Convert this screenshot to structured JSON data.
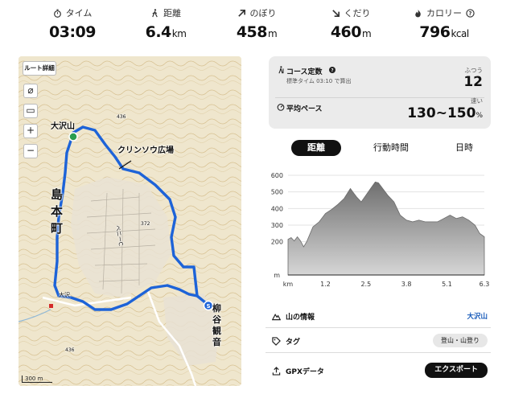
{
  "stats": [
    {
      "label": "タイム",
      "value": "03:09",
      "unit": "",
      "icon": "stopwatch-icon"
    },
    {
      "label": "距離",
      "value": "6.4",
      "unit": "km",
      "icon": "walker-icon"
    },
    {
      "label": "のぼり",
      "value": "458",
      "unit": "m",
      "icon": "arrow-up-right-icon"
    },
    {
      "label": "くだり",
      "value": "460",
      "unit": "m",
      "icon": "arrow-down-right-icon"
    },
    {
      "label": "カロリー",
      "value": "796",
      "unit": "kcal",
      "icon": "flame-icon"
    }
  ],
  "map": {
    "route_button": "ルート詳細",
    "labels": {
      "peak": "大沢山",
      "plaza": "クリンソウ広場",
      "town": "島本町",
      "temple": "柳谷観音",
      "oosawa": "大沢",
      "street": "ベニーC",
      "num1": "436",
      "num2": "372",
      "num3": "436",
      "small_label": "大沢"
    },
    "scale": "300 m",
    "controls": {
      "compass": "⌀",
      "layers": "▭",
      "zoom_in": "+",
      "zoom_out": "−"
    }
  },
  "course": {
    "title": "コース定数",
    "subtitle": "標準タイム 03:10 で算出",
    "difficulty": "ふつう",
    "value": "12",
    "pace_title": "平均ペース",
    "pace_note": "速い",
    "pace_value": "130~150",
    "pace_unit": "%"
  },
  "tabs": [
    {
      "label": "距離",
      "active": true
    },
    {
      "label": "行動時間",
      "active": false
    },
    {
      "label": "日時",
      "active": false
    }
  ],
  "chart_data": {
    "type": "area",
    "x": [
      0,
      0.1,
      0.2,
      0.3,
      0.4,
      0.5,
      0.6,
      0.8,
      1.0,
      1.2,
      1.4,
      1.6,
      1.8,
      2.0,
      2.1,
      2.2,
      2.35,
      2.5,
      2.65,
      2.8,
      2.9,
      3.0,
      3.2,
      3.4,
      3.6,
      3.8,
      4.0,
      4.2,
      4.4,
      4.6,
      4.8,
      5.0,
      5.2,
      5.4,
      5.6,
      5.8,
      6.0,
      6.15,
      6.3
    ],
    "y": [
      215,
      225,
      205,
      230,
      205,
      170,
      200,
      290,
      320,
      370,
      395,
      425,
      460,
      520,
      495,
      470,
      440,
      480,
      520,
      560,
      555,
      530,
      480,
      440,
      360,
      330,
      320,
      330,
      320,
      320,
      320,
      340,
      360,
      340,
      350,
      330,
      300,
      250,
      230
    ],
    "ylim": [
      0,
      600
    ],
    "xlim": [
      0,
      6.3
    ],
    "yticks": [
      200,
      300,
      400,
      500,
      600
    ],
    "ytick_labels": [
      "200",
      "300",
      "400",
      "500",
      "600"
    ],
    "y_unit": "m",
    "x_unit": "km",
    "xticks": [
      1.2,
      2.5,
      3.8,
      5.1,
      6.3
    ],
    "xtick_labels": [
      "1.2",
      "2.5",
      "3.8",
      "5.1",
      "6.3"
    ],
    "grid": true
  },
  "info": {
    "mountain_label": "山の情報",
    "mountain_value": "大沢山",
    "tag_label": "タグ",
    "tag_value": "登山・山登り",
    "gpx_label": "GPXデータ",
    "export_button": "エクスポート"
  }
}
